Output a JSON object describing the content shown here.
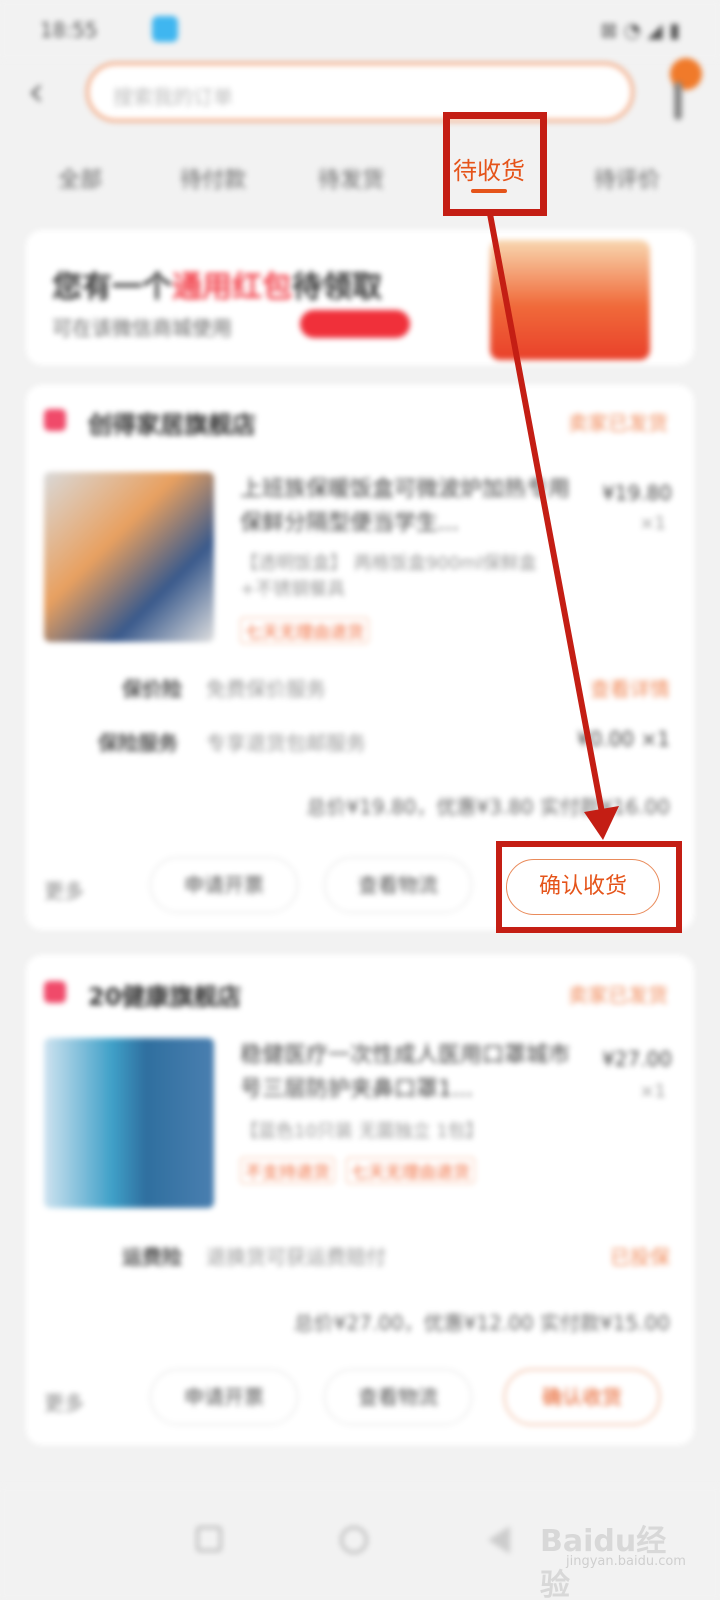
{
  "status_bar": {
    "time": "18:55",
    "right": "⊠ ◔ ◢ ▮"
  },
  "header": {
    "search_placeholder": "搜索我的订单"
  },
  "tabs": [
    {
      "label": "全部"
    },
    {
      "label": "待付款"
    },
    {
      "label": "待发货"
    },
    {
      "label": "待收货",
      "active": true
    },
    {
      "label": "待评价"
    }
  ],
  "promo": {
    "title_before": "您有一个",
    "title_highlight": "通用红包",
    "title_after": "待领取",
    "subtitle": "可在该微信商城使用"
  },
  "orders": [
    {
      "shop_name": "创得家居旗舰店",
      "status": "卖家已发货",
      "product_title": "上班族保暖饭盒可微波炉加热专用保鲜分隔型便当学生...",
      "product_spec": "【透明饭盒】 两格饭盒900ml保鲜盒+不锈钢餐具",
      "product_tag": "七天无理由退货",
      "price": "¥19.80",
      "qty": "×1",
      "rows": [
        {
          "label": "保价险",
          "value": "免费保价服务",
          "right": "查看详情"
        },
        {
          "label": "保险服务",
          "value": "专享退货包邮服务",
          "right": "¥0.00 ×1"
        }
      ],
      "summary": "总价¥19.80，优惠¥3.80 实付款¥16.00",
      "more": "更多",
      "buttons": [
        "申请开票",
        "查看物流",
        "确认收货"
      ]
    },
    {
      "shop_name": "20健康旗舰店",
      "status": "卖家已发货",
      "product_title": "稳健医疗一次性成人医用口罩城市号三层防护夹鼻口罩1...",
      "product_spec": "【蓝色10只装 无菌独立 1包】",
      "product_tags": [
        "不支持退货",
        "七天无理由退货"
      ],
      "price": "¥27.00",
      "qty": "×1",
      "rows": [
        {
          "label": "运费险",
          "value": "退换货可获运费赔付",
          "right": "已投保"
        }
      ],
      "summary": "总价¥27.00，优惠¥12.00 实付款¥15.00",
      "more": "更多",
      "buttons": [
        "申请开票",
        "查看物流",
        "确认收货"
      ]
    }
  ],
  "highlight": {
    "tab_label": "待收货",
    "confirm_label": "确认收货",
    "annotation_color": "#c41e14"
  },
  "watermark": {
    "brand": "Baidu经验",
    "url": "jingyan.baidu.com"
  },
  "colors": {
    "accent": "#e5541a",
    "annotation": "#c41e14",
    "background": "#f2f2f2"
  }
}
